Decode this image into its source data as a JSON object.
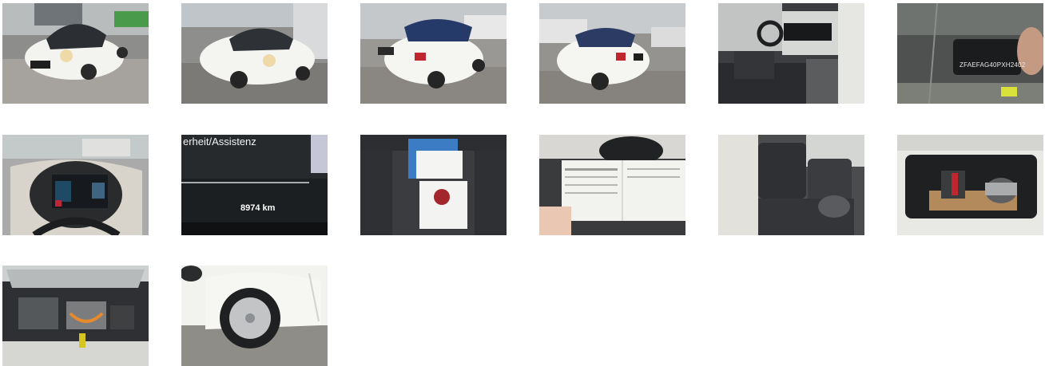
{
  "gallery": {
    "photos": [
      {
        "subject": "front-left-exterior"
      },
      {
        "subject": "front-right-exterior"
      },
      {
        "subject": "rear-left-exterior"
      },
      {
        "subject": "rear-right-exterior"
      },
      {
        "subject": "interior-front-seats"
      },
      {
        "subject": "vin-plate",
        "text": "ZFAEFAG40PXH2402"
      },
      {
        "subject": "instrument-cluster"
      },
      {
        "subject": "odometer",
        "heading": "erheit/Assistenz",
        "mileage": "8974 km"
      },
      {
        "subject": "documents-folder"
      },
      {
        "subject": "service-booklet"
      },
      {
        "subject": "rear-seats"
      },
      {
        "subject": "trunk"
      },
      {
        "subject": "engine-bay"
      },
      {
        "subject": "wheel-detail"
      }
    ]
  }
}
